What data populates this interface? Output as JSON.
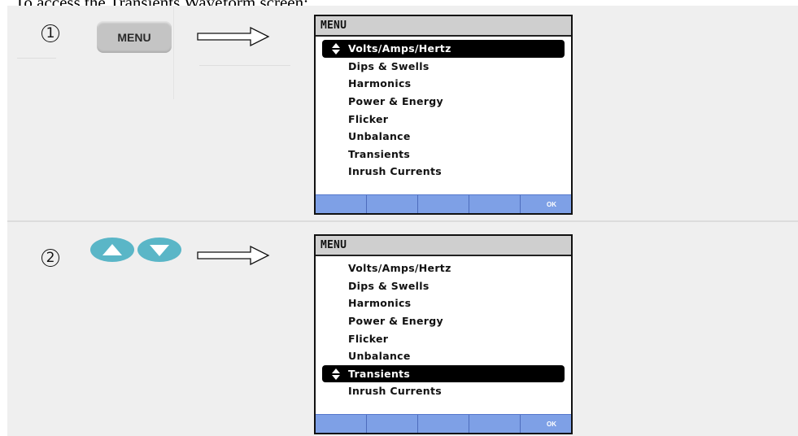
{
  "intro_text": "To access the Transients Waveform screen:",
  "steps": [
    {
      "number": "1",
      "key_label": "MENU",
      "screen": {
        "title": "MENU",
        "items": [
          "Volts/Amps/Hertz",
          "Dips & Swells",
          "Harmonics",
          "Power & Energy",
          "Flicker",
          "Unbalance",
          "Transients",
          "Inrush Currents"
        ],
        "selected_index": 0,
        "softkeys": [
          "",
          "",
          "",
          "",
          "OK"
        ]
      }
    },
    {
      "number": "2",
      "key_icons": [
        "arrow-up-key",
        "arrow-down-key"
      ],
      "screen": {
        "title": "MENU",
        "items": [
          "Volts/Amps/Hertz",
          "Dips & Swells",
          "Harmonics",
          "Power & Energy",
          "Flicker",
          "Unbalance",
          "Transients",
          "Inrush Currents"
        ],
        "selected_index": 6,
        "softkeys": [
          "",
          "",
          "",
          "",
          "OK"
        ]
      }
    }
  ],
  "colors": {
    "panel_bg": "#efefef",
    "key_gray": "#c4c4c4",
    "arrow_key_teal": "#5ab6c7",
    "softkey_blue": "#7ea0e6",
    "title_bar_gray": "#cfcfcf"
  }
}
